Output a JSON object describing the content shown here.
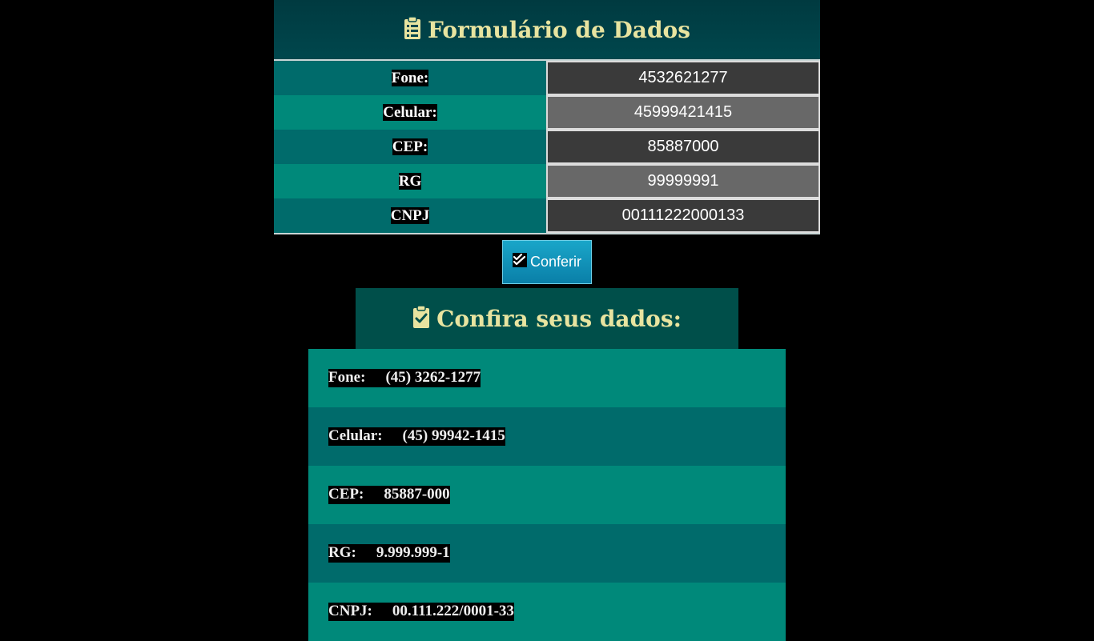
{
  "form": {
    "title": "Formulário de Dados",
    "fields": [
      {
        "label": "Fone:",
        "value": "4532621277"
      },
      {
        "label": "Celular:",
        "value": "45999421415"
      },
      {
        "label": "CEP:",
        "value": "85887000"
      },
      {
        "label": "RG",
        "value": "99999991"
      },
      {
        "label": "CNPJ",
        "value": "00111222000133"
      }
    ]
  },
  "button": {
    "label": "Conferir"
  },
  "result": {
    "title": "Confira seus dados:",
    "rows": [
      {
        "label": "Fone:",
        "value": "(45) 3262-1277"
      },
      {
        "label": "Celular:",
        "value": "(45) 99942-1415"
      },
      {
        "label": "CEP:",
        "value": "85887-000"
      },
      {
        "label": "RG:",
        "value": "9.999.999-1"
      },
      {
        "label": "CNPJ:",
        "value": "00.111.222/0001-33"
      }
    ]
  },
  "colors": {
    "title": "#e8e4a0",
    "header_bg": "#00474d",
    "row_dark": "#006b6b",
    "row_light": "#00897a",
    "button": "#0a7fa8"
  },
  "icons": {
    "form_header": "clipboard-list-icon",
    "button": "check-double-icon",
    "result_header": "clipboard-check-icon"
  }
}
